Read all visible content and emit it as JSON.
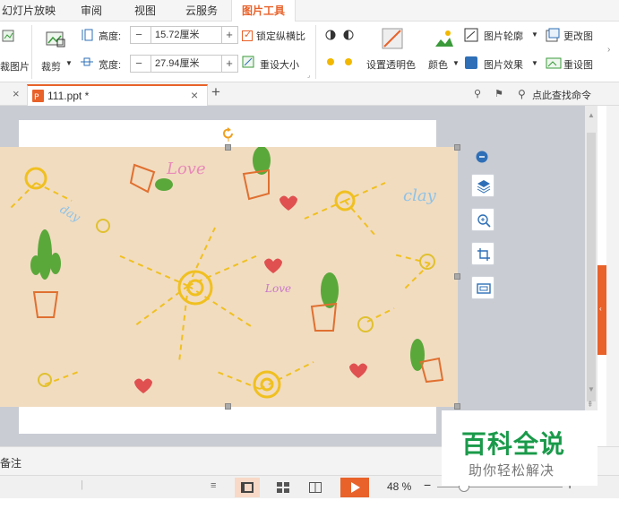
{
  "menu": {
    "items": [
      "幻灯片放映",
      "审阅",
      "视图",
      "云服务"
    ],
    "active": "图片工具"
  },
  "ribbon": {
    "crop_image_label": "裁图片",
    "crop_label": "裁剪",
    "height_label": "高度:",
    "height_value": "15.72厘米",
    "width_label": "宽度:",
    "width_value": "27.94厘米",
    "lock_ratio_label": "锁定纵横比",
    "reset_size_label": "重设大小",
    "transparent_label": "设置透明色",
    "color_label": "颜色",
    "outline_label": "图片轮廓",
    "effect_label": "图片效果",
    "change_label": "更改图",
    "reset_label": "重设图"
  },
  "tabs": {
    "doc_name": "111.ppt *",
    "search_command": "点此查找命令"
  },
  "picture": {
    "texts": [
      "Love",
      "clay",
      "day",
      "clay",
      "Love"
    ]
  },
  "notes": {
    "label": "备注"
  },
  "status": {
    "zoom": "48 %"
  },
  "watermark": {
    "title": "百科全说",
    "subtitle": "助你轻松解决"
  },
  "colors": {
    "accent": "#e8622a",
    "brand": "#1a9a4a",
    "picture_bg": "#f1dcc0"
  }
}
